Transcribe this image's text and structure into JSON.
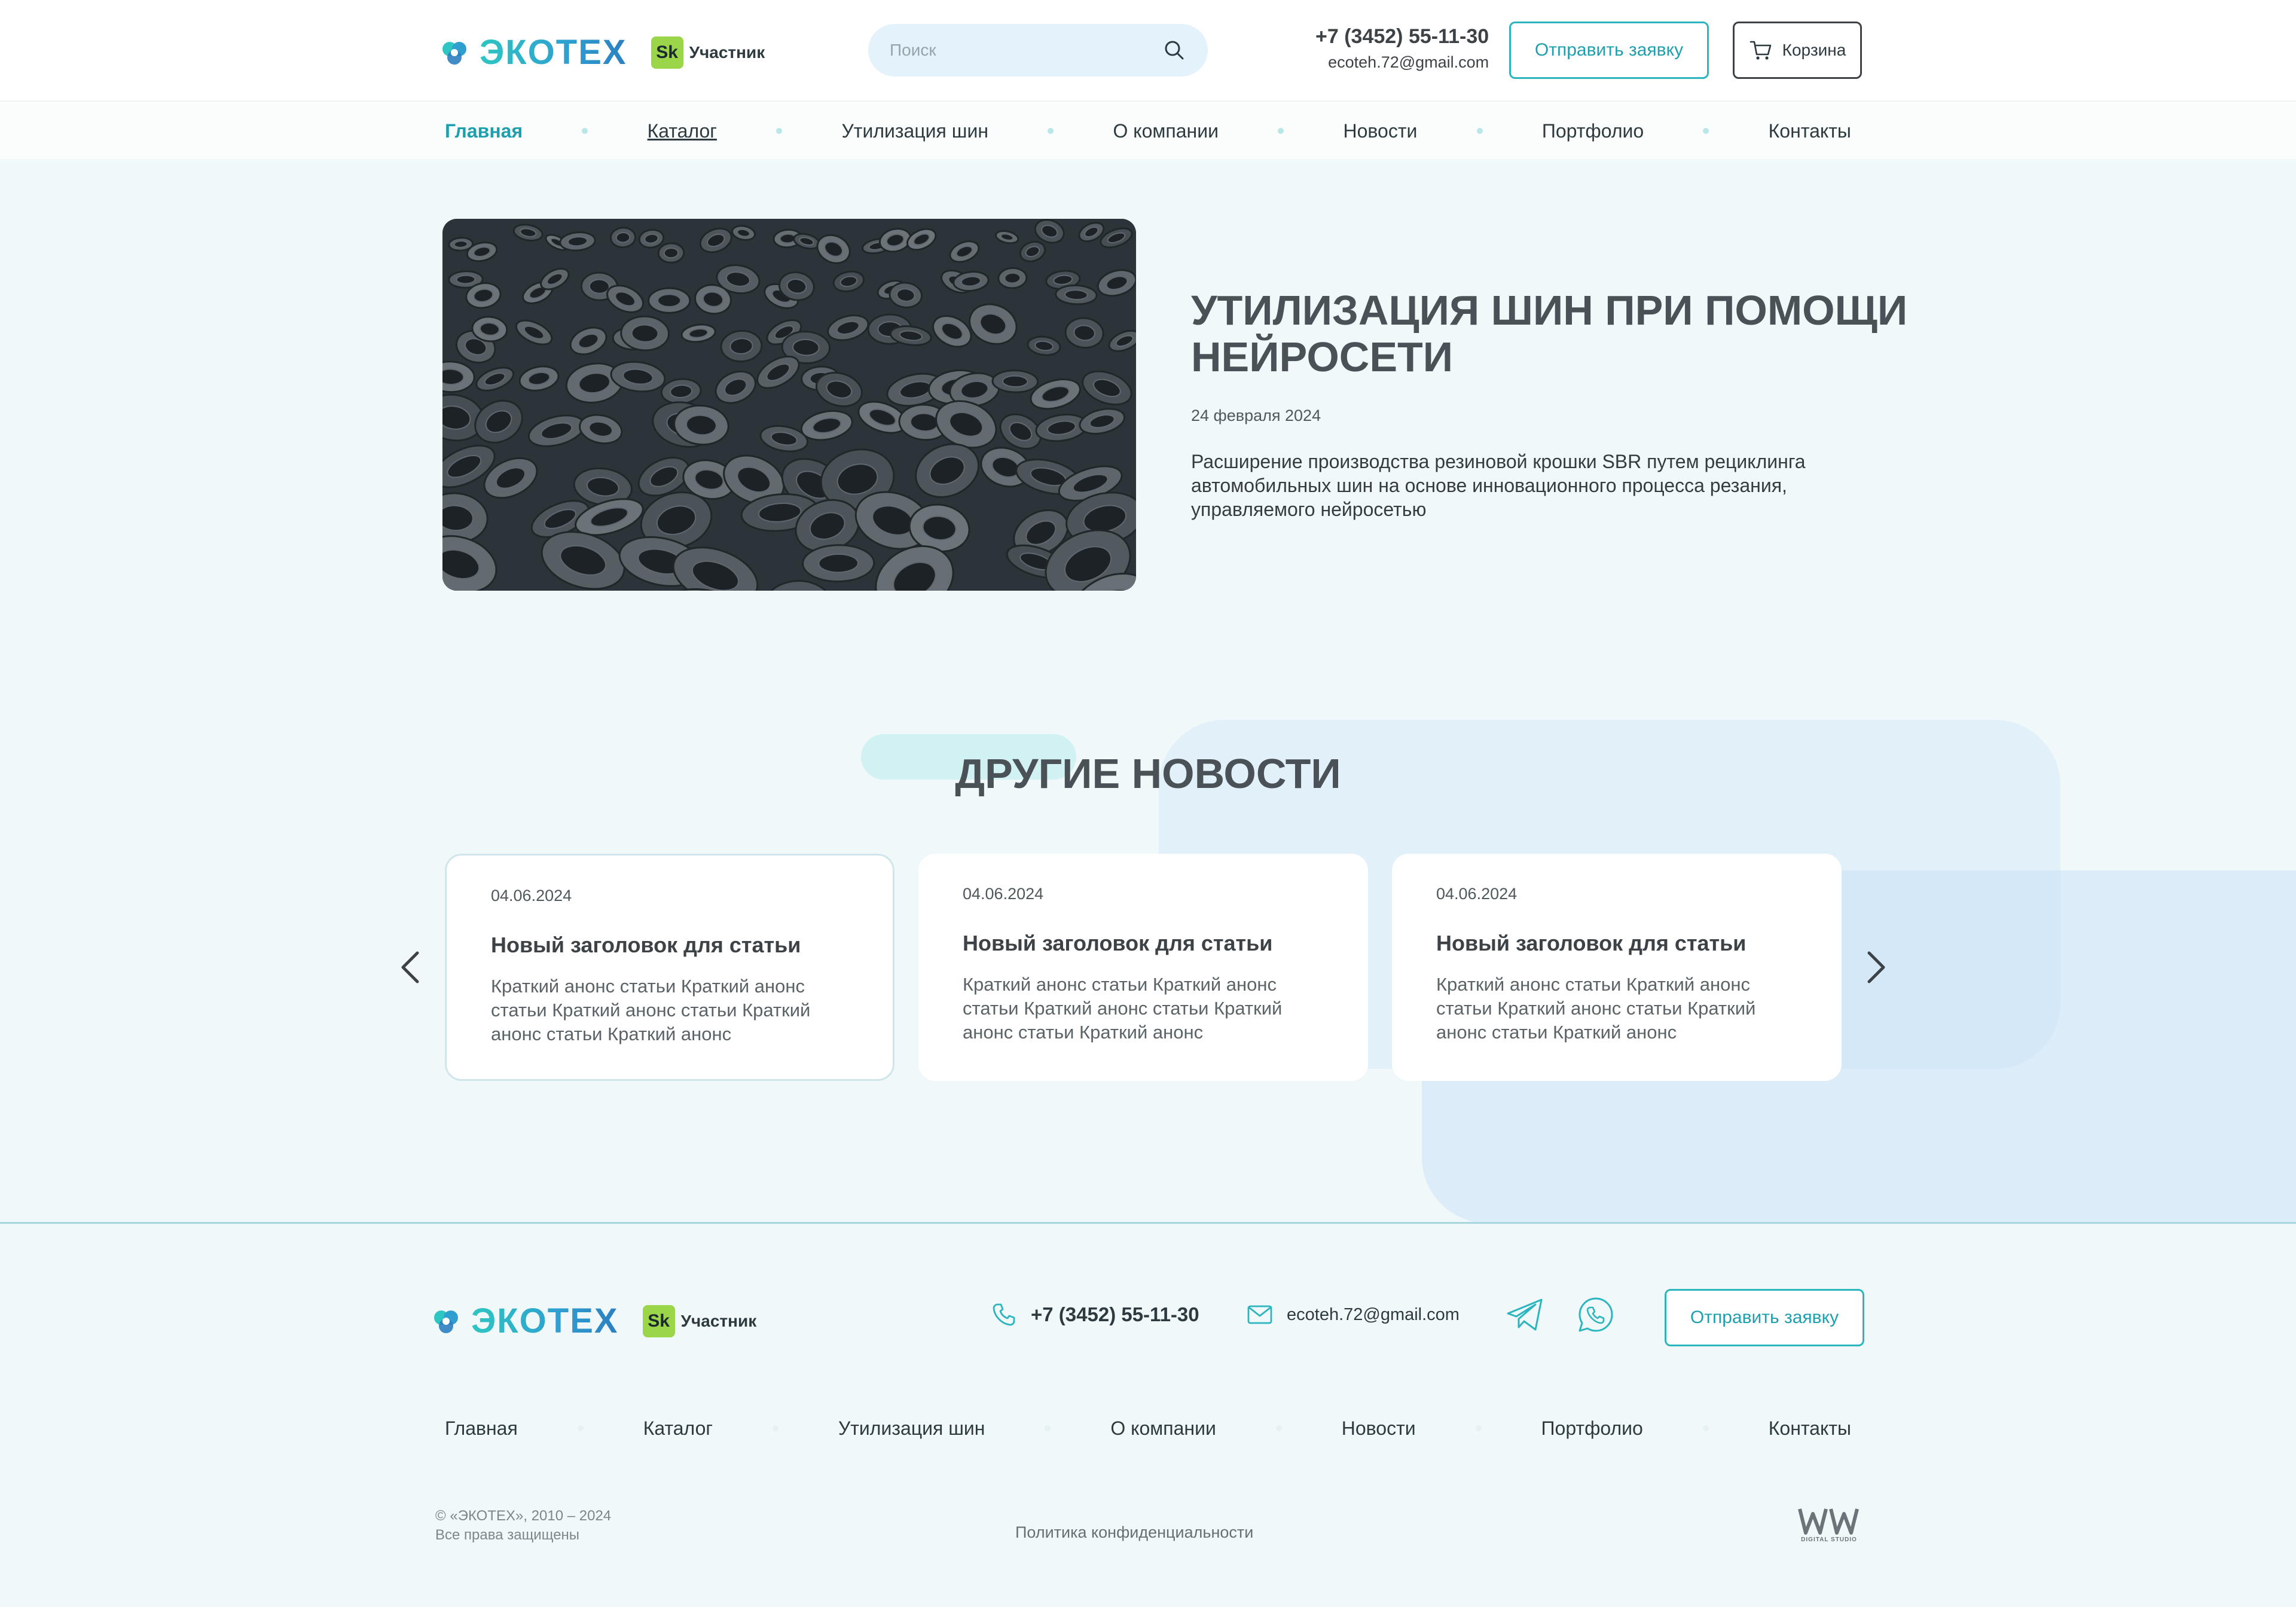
{
  "brand": {
    "name": "ЭКОТЕХ",
    "sk_badge": "Sk",
    "sk_label": "Участник"
  },
  "search": {
    "placeholder": "Поиск"
  },
  "contact": {
    "phone": "+7 (3452) 55-11-30",
    "email": "ecoteh.72@gmail.com"
  },
  "buttons": {
    "request": "Отправить заявку",
    "cart": "Корзина"
  },
  "nav": {
    "items": [
      {
        "label": "Главная"
      },
      {
        "label": "Каталог"
      },
      {
        "label": "Утилизация шин"
      },
      {
        "label": "О компании"
      },
      {
        "label": "Новости"
      },
      {
        "label": "Портфолио"
      },
      {
        "label": "Контакты"
      }
    ]
  },
  "article": {
    "title": "Утилизация шин при помощи нейросети",
    "date": "24 февраля 2024",
    "description": "Расширение производства резиновой крошки SBR путем рециклинга автомобильных шин на основе инновационного процесса резания, управляемого нейросетью"
  },
  "other_news": {
    "title": "Другие новости",
    "cards": [
      {
        "date": "04.06.2024",
        "title": "Новый заголовок для статьи",
        "text": "Краткий анонс статьи Краткий анонс статьи Краткий анонс статьи Краткий анонс статьи Краткий анонс"
      },
      {
        "date": "04.06.2024",
        "title": "Новый заголовок для статьи",
        "text": "Краткий анонс статьи Краткий анонс статьи Краткий анонс статьи Краткий анонс статьи Краткий анонс"
      },
      {
        "date": "04.06.2024",
        "title": "Новый заголовок для статьи",
        "text": "Краткий анонс статьи Краткий анонс статьи Краткий анонс статьи Краткий анонс статьи Краткий анонс"
      }
    ]
  },
  "footer": {
    "copyright_line1": "© «ЭКОТЕХ», 2010 – 2024",
    "copyright_line2": "Все права защищены",
    "policy": "Политика конфиденциальности",
    "studio_label": "DIGITAL STUDIO"
  },
  "colors": {
    "accent": "#1e9fae",
    "page_bg": "#f1f8fa",
    "sk_green": "#9bd54a"
  },
  "icons": [
    "logo-mark-icon",
    "search-icon",
    "cart-icon",
    "chevron-left-icon",
    "chevron-right-icon",
    "phone-icon",
    "mail-icon",
    "telegram-icon",
    "whatsapp-icon",
    "studio-logo-icon"
  ]
}
